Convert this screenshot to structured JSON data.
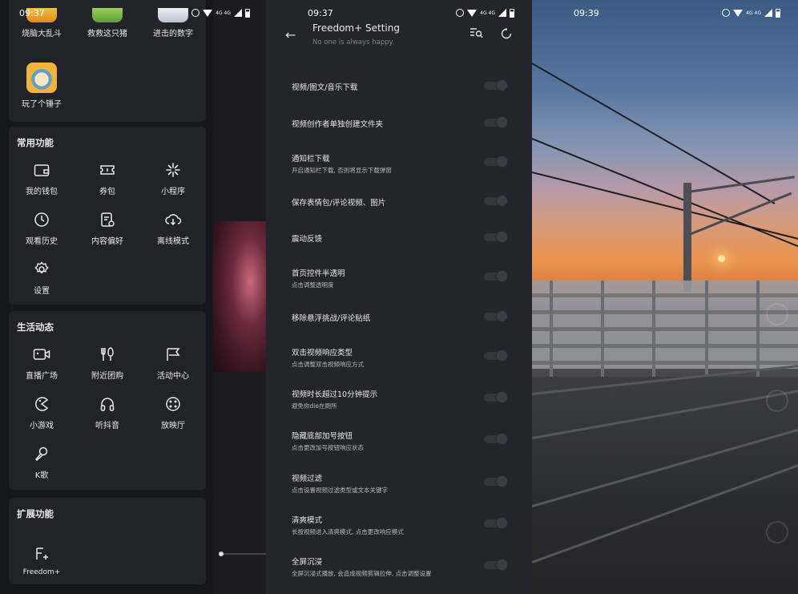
{
  "panel1": {
    "status": {
      "time": "09:37",
      "net": "4G 4G"
    },
    "games": [
      {
        "label": "烧脑大乱斗"
      },
      {
        "label": "救救这只猪"
      },
      {
        "label": "进击的数字"
      },
      {
        "label": "玩了个锤子"
      }
    ],
    "common": {
      "title": "常用功能",
      "items": [
        {
          "label": "我的钱包",
          "icon": "wallet-icon"
        },
        {
          "label": "券包",
          "icon": "ticket-icon"
        },
        {
          "label": "小程序",
          "icon": "mini-program-icon"
        },
        {
          "label": "观看历史",
          "icon": "clock-icon"
        },
        {
          "label": "内容偏好",
          "icon": "preference-icon"
        },
        {
          "label": "离线模式",
          "icon": "cloud-download-icon"
        },
        {
          "label": "设置",
          "icon": "gear-icon"
        }
      ]
    },
    "life": {
      "title": "生活动态",
      "items": [
        {
          "label": "直播广场",
          "icon": "live-camera-icon"
        },
        {
          "label": "附近团购",
          "icon": "fork-knife-icon"
        },
        {
          "label": "活动中心",
          "icon": "flag-icon"
        },
        {
          "label": "小游戏",
          "icon": "pacman-icon"
        },
        {
          "label": "听抖音",
          "icon": "headphones-icon"
        },
        {
          "label": "放映厅",
          "icon": "film-reel-icon"
        },
        {
          "label": "K歌",
          "icon": "microphone-icon"
        }
      ]
    },
    "extend": {
      "title": "扩展功能",
      "items": [
        {
          "label": "Freedom+",
          "icon": "freedom-plus-icon"
        }
      ]
    }
  },
  "panel2": {
    "status": {
      "time": "09:37",
      "net": "4G 4G"
    },
    "header": {
      "title": "Freedom+ Setting",
      "subtitle": "No one is always happy."
    },
    "settings": [
      {
        "title": "视频/图文/音乐下载",
        "desc": ""
      },
      {
        "title": "视频创作者单独创建文件夹",
        "desc": ""
      },
      {
        "title": "通知栏下载",
        "desc": "开启通知栏下载, 否则将显示下载弹窗"
      },
      {
        "title": "保存表情包/评论视频、图片",
        "desc": ""
      },
      {
        "title": "震动反馈",
        "desc": ""
      },
      {
        "title": "首页控件半透明",
        "desc": "点击调整透明度"
      },
      {
        "title": "移除悬浮挑战/评论贴纸",
        "desc": ""
      },
      {
        "title": "双击视频响应类型",
        "desc": "点击调整双击视频响应方式"
      },
      {
        "title": "视频时长超过10分钟提示",
        "desc": "避免你die在厕所"
      },
      {
        "title": "隐藏底部加号按钮",
        "desc": "点击更改加号按钮响应状态"
      },
      {
        "title": "视频过滤",
        "desc": "点击设置视频过滤类型或文本关键字"
      },
      {
        "title": "清爽模式",
        "desc": "长按视频进入清爽模式, 点击更改响应模式"
      },
      {
        "title": "全屏沉浸",
        "desc": "全屏沉浸式播放, 会造成视频剪辑拉伸, 点击调整设置"
      }
    ]
  },
  "panel3": {
    "status": {
      "time": "09:39",
      "net": "4G 4G"
    }
  },
  "colors": {
    "panel_bg": "#24252c",
    "drawer_bg": "#16171c",
    "card_bg": "#22232a",
    "text": "#e8e8ec",
    "subtext": "#80818a"
  }
}
